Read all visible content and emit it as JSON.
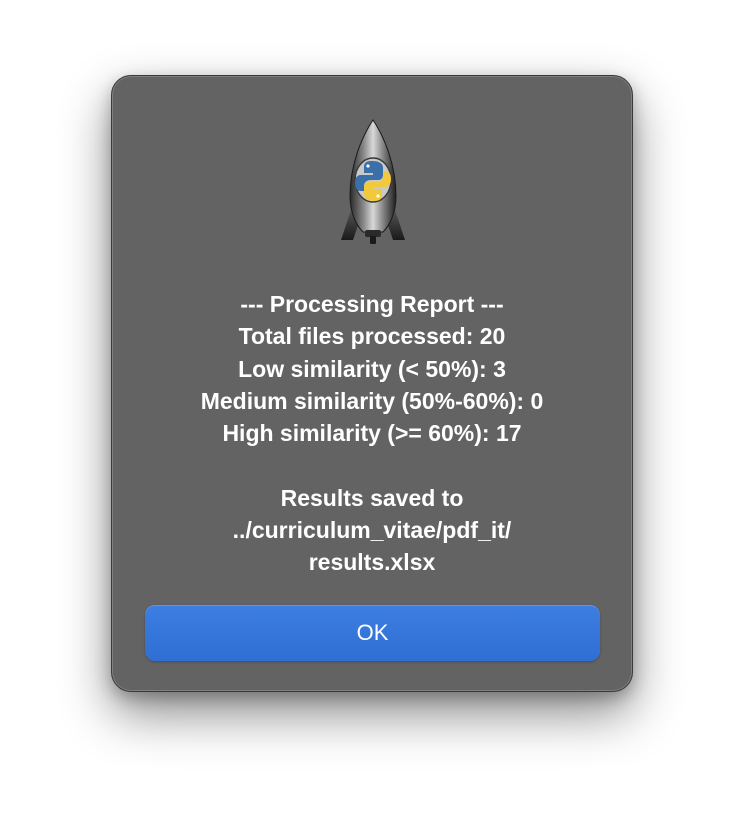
{
  "dialog": {
    "icon": "python-launcher-rocket-icon",
    "message": {
      "header": "--- Processing Report ---",
      "total_files": "Total files processed: 20",
      "low_similarity": "Low similarity (< 50%): 3",
      "medium_similarity": "Medium similarity (50%-60%): 0",
      "high_similarity": "High similarity (>= 60%): 17",
      "saved_to": "Results saved to",
      "path_dir": "../curriculum_vitae/pdf_it/",
      "path_file": "results.xlsx"
    },
    "ok_label": "OK"
  },
  "colors": {
    "dialog_background": "#636363",
    "button_accent": "#3778dc",
    "text": "#ffffff"
  }
}
